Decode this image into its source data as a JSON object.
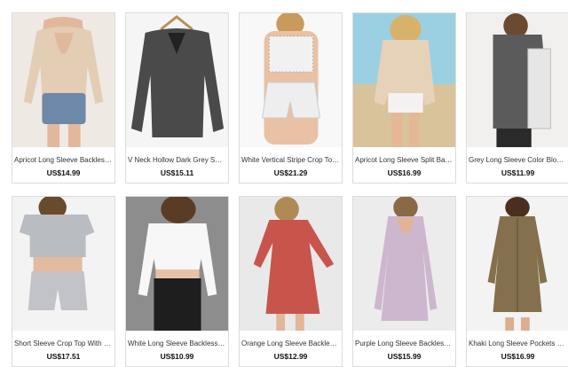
{
  "products": [
    {
      "name": "Apricot Long Sleeve Backless T-Shirt",
      "price": "US$14.99",
      "image": "apricot-backless-tee-photo",
      "colors": {
        "bg": "#efe9e3",
        "top": "#e3cdb5",
        "bottom": "#6d88a8",
        "skin": "#e2b89c"
      }
    },
    {
      "name": "V Neck Hollow Dark Grey Sweater",
      "price": "US$15.11",
      "image": "dark-grey-sweater-photo",
      "colors": {
        "bg": "#f5f5f5",
        "top": "#4a4a4a",
        "bottom": "#4a4a4a",
        "skin": "#f5f5f5"
      }
    },
    {
      "name": "White Vertical Stripe Crop Top With Shorts",
      "price": "US$21.29",
      "image": "stripe-crop-top-set-photo",
      "colors": {
        "bg": "#f8f8f8",
        "top": "#f1f1f1",
        "bottom": "#eeeeee",
        "skin": "#e9c1a4"
      }
    },
    {
      "name": "Apricot Long Sleeve Split Back T-Shirt",
      "price": "US$16.99",
      "image": "split-back-tee-beach-photo",
      "colors": {
        "bg": "#9ad0e2",
        "top": "#e5d2b9",
        "bottom": "#f4f1f3",
        "skin": "#e4b897"
      }
    },
    {
      "name": "Grey Long Sleeve Color Block Sweater",
      "price": "US$11.99",
      "image": "color-block-sweater-photo",
      "colors": {
        "bg": "#f2f0ee",
        "top": "#5b5b5b",
        "bottom": "#2a2a2a",
        "skin": "#dcb49a"
      }
    },
    {
      "name": "Short Sleeve Crop Top With Slim Shorts",
      "price": "US$17.51",
      "image": "grey-crop-top-shorts-photo",
      "colors": {
        "bg": "#f3f3f3",
        "top": "#b9bcc1",
        "bottom": "#c1c3c8",
        "skin": "#e3bb9f"
      }
    },
    {
      "name": "White Long Sleeve Backless Crop Top",
      "price": "US$10.99",
      "image": "white-crop-top-photo",
      "colors": {
        "bg": "#8d8d8d",
        "top": "#f7f7f7",
        "bottom": "#1e1e1e",
        "skin": "#e6c3a8"
      }
    },
    {
      "name": "Orange Long Sleeve Backless Casual Dress",
      "price": "US$12.99",
      "image": "orange-backless-dress-photo",
      "colors": {
        "bg": "#e9e9e9",
        "top": "#c8554c",
        "bottom": "#c8554c",
        "skin": "#e1b69a"
      }
    },
    {
      "name": "Purple Long Sleeve Backless Dress",
      "price": "US$15.99",
      "image": "purple-backless-dress-photo",
      "colors": {
        "bg": "#ececec",
        "top": "#cdb7cf",
        "bottom": "#cdb7cf",
        "skin": "#e0b496"
      }
    },
    {
      "name": "Khaki Long Sleeve Pockets Dress",
      "price": "US$16.99",
      "image": "khaki-pocket-dress-photo",
      "colors": {
        "bg": "#f3f3f3",
        "top": "#85704d",
        "bottom": "#85704d",
        "skin": "#dcae90"
      }
    }
  ]
}
